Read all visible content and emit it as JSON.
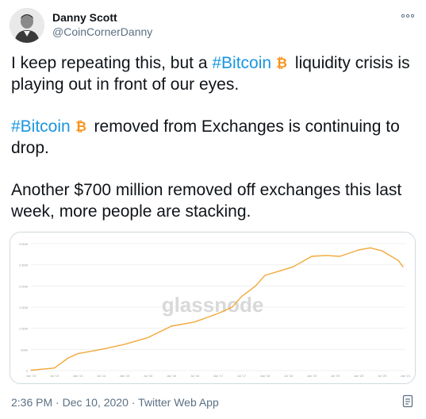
{
  "tweet": {
    "author_name": "Danny Scott",
    "author_handle": "@CoinCornerDanny",
    "paragraph1": {
      "before": "I keep repeating this, but a ",
      "hashtag": "#Bitcoin",
      "after": " liquidity crisis is playing out in front of our eyes."
    },
    "paragraph2": {
      "hashtag": "#Bitcoin",
      "after": " removed from Exchanges is continuing to drop."
    },
    "paragraph3": "Another $700 million removed off exchanges this last week, more people are stacking.",
    "timestamp": "2:36 PM · Dec 10, 2020",
    "separator": " · ",
    "source": "Twitter Web App"
  },
  "icons": {
    "more": "more-horizontal-icon",
    "bitcoin": "bitcoin-emoji-icon",
    "analytics": "analytics-icon"
  },
  "colors": {
    "hashtag": "#1b95e0",
    "bitcoin": "#f7931a",
    "chart_line": "#f2a93b",
    "secondary_text": "#5b7083"
  },
  "media": {
    "watermark": "glassnode"
  },
  "chart_data": {
    "type": "line",
    "title": "",
    "xlabel": "",
    "ylabel": "",
    "y_ticks": [
      "0",
      "500k",
      "1.00M",
      "1.50M",
      "2.00M",
      "2.50M",
      "3.00M"
    ],
    "ylim": [
      0,
      3000000
    ],
    "x_ticks": [
      "Jan '13",
      "Jul '13",
      "Jan '14",
      "Jul '14",
      "Jan '15",
      "Jul '15",
      "Jan '16",
      "Jul '16",
      "Jan '17",
      "Jul '17",
      "Jan '18",
      "Jul '18",
      "Jan '19",
      "Jul '19",
      "Jan '20",
      "Jul '20",
      "Jan '21"
    ],
    "x": [
      2013.0,
      2013.5,
      2013.8,
      2014.0,
      2014.5,
      2015.0,
      2015.5,
      2016.0,
      2016.5,
      2017.0,
      2017.3,
      2017.5,
      2017.8,
      2018.0,
      2018.3,
      2018.6,
      2019.0,
      2019.3,
      2019.6,
      2020.0,
      2020.25,
      2020.5,
      2020.7,
      2020.85,
      2020.95
    ],
    "series": [
      {
        "values": [
          10000,
          60000,
          300000,
          400000,
          500000,
          620000,
          780000,
          1050000,
          1150000,
          1350000,
          1500000,
          1750000,
          2000000,
          2250000,
          2350000,
          2450000,
          2700000,
          2720000,
          2700000,
          2850000,
          2900000,
          2830000,
          2700000,
          2600000,
          2450000
        ]
      }
    ]
  }
}
